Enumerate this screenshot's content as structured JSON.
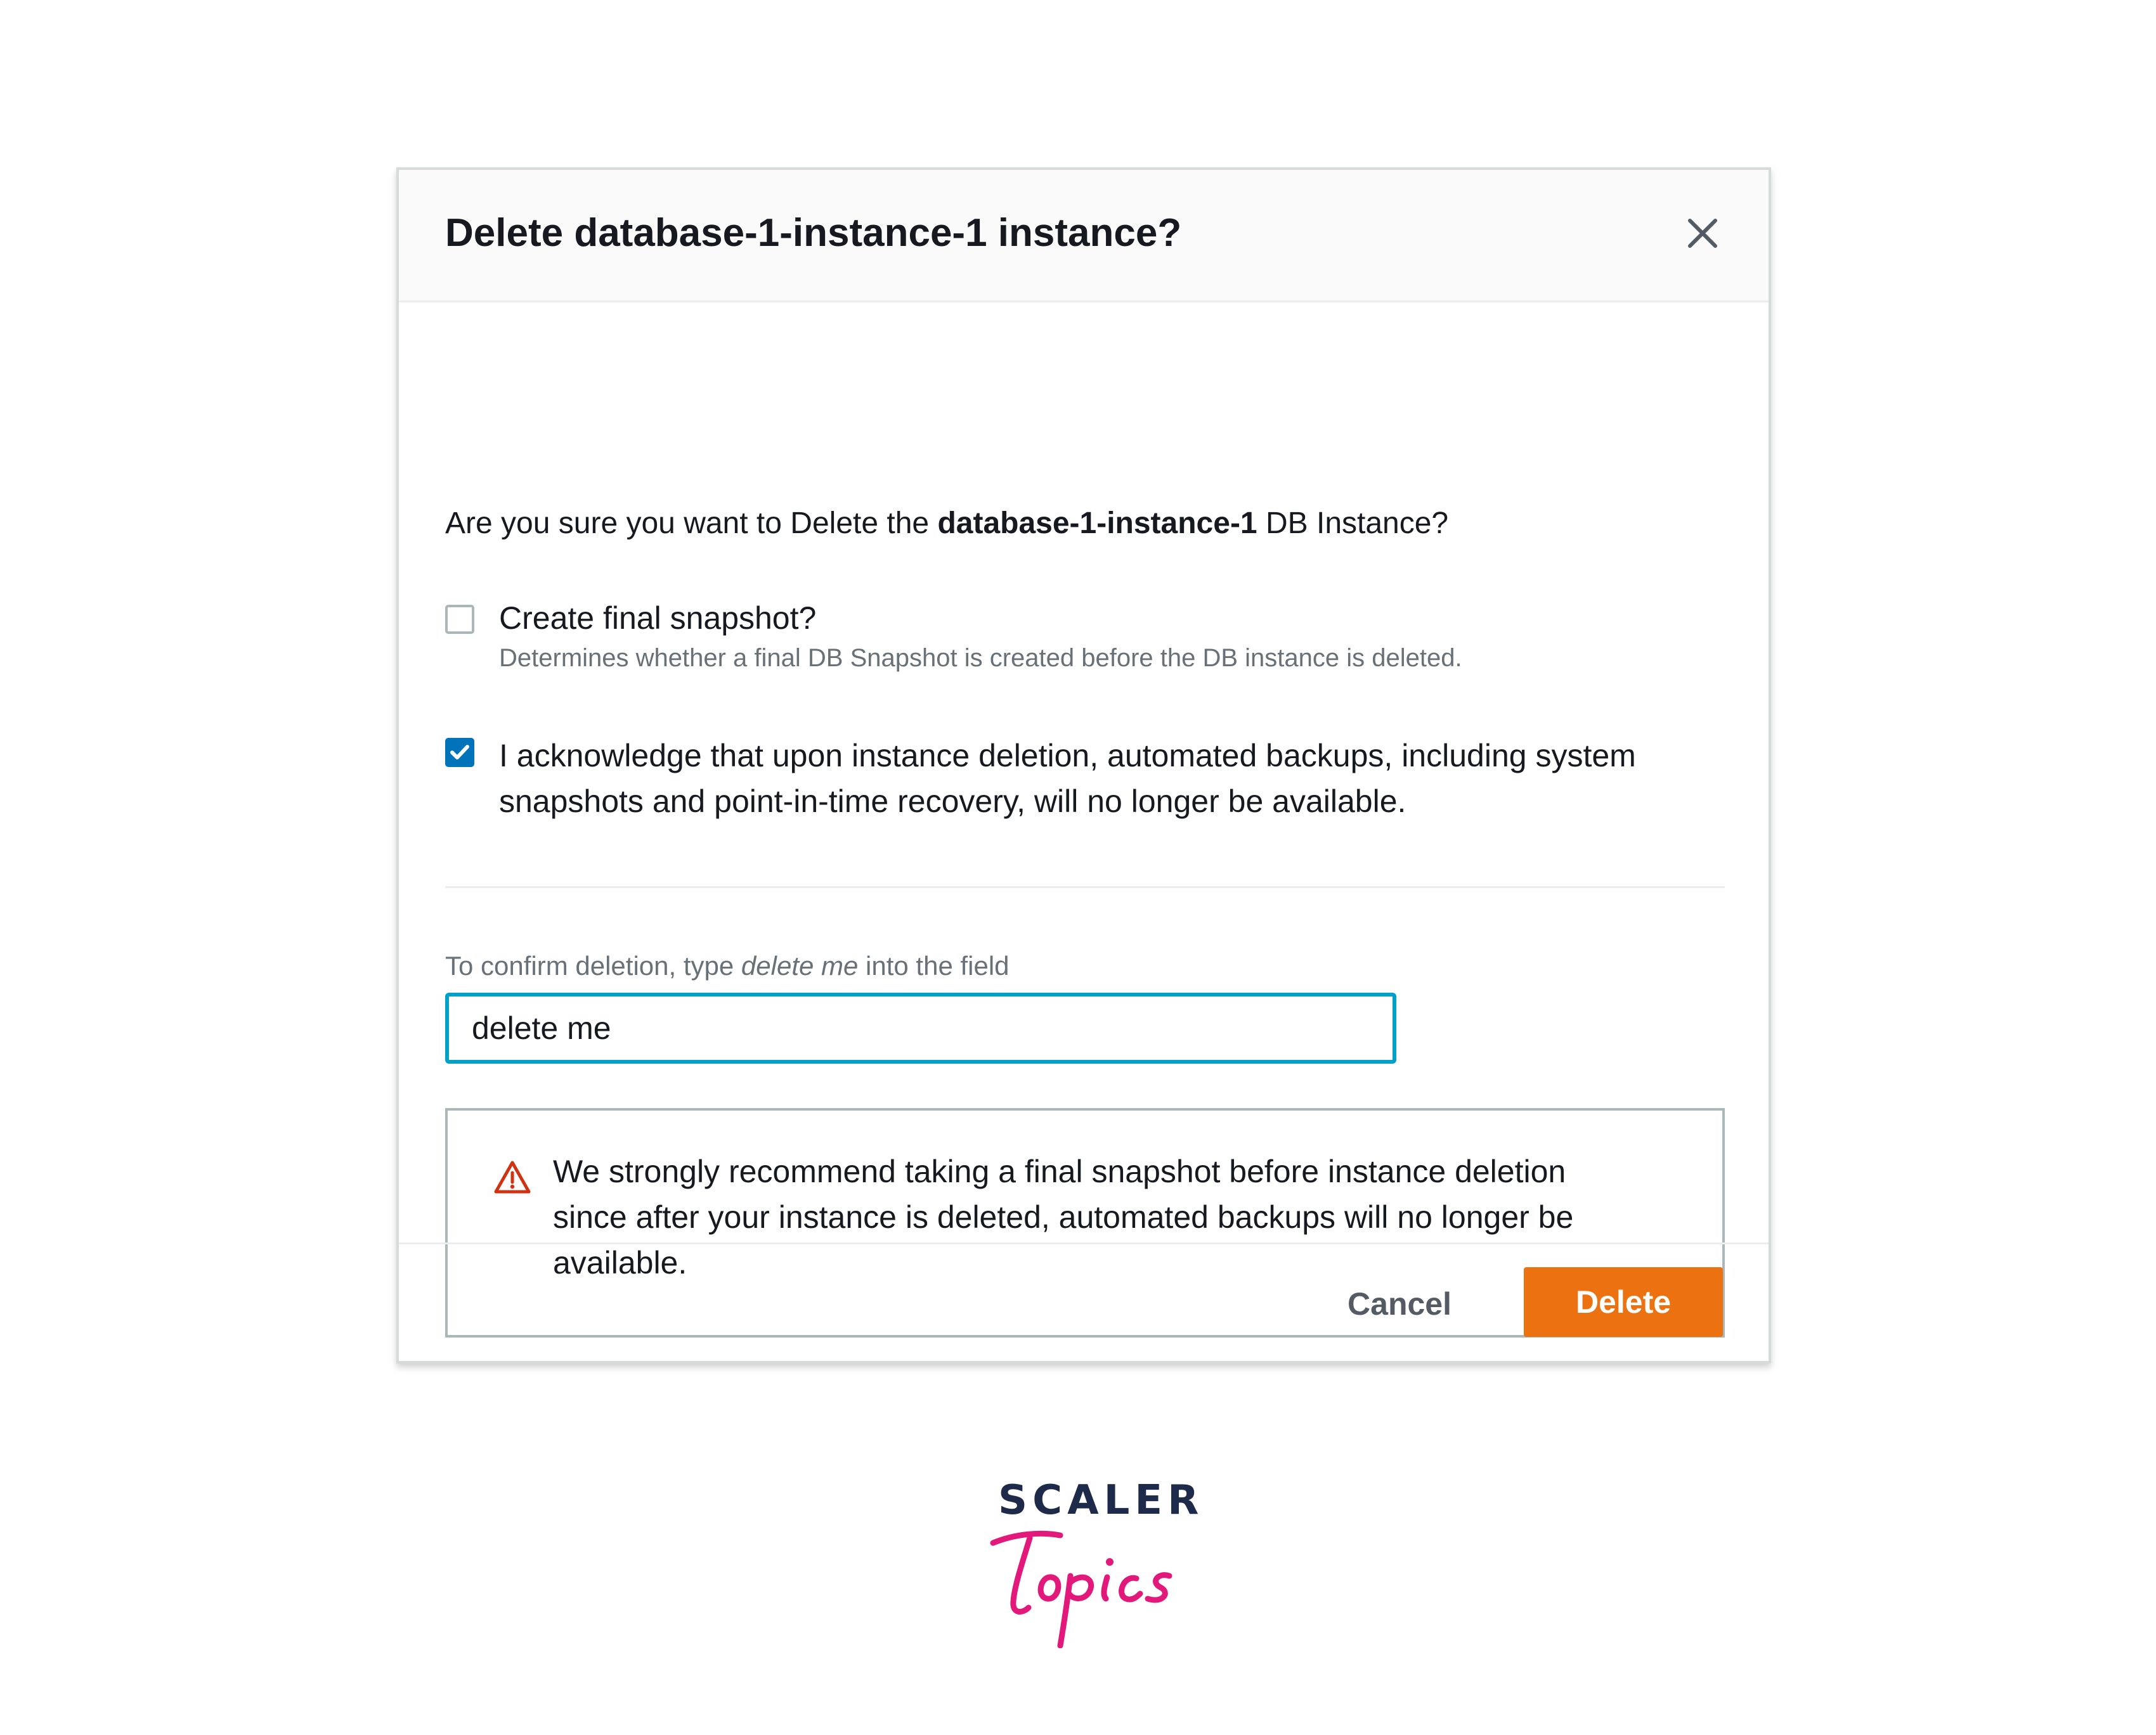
{
  "modal": {
    "title": "Delete database-1-instance-1 instance?",
    "question": {
      "prefix": "Are you sure you want to Delete the ",
      "instance_name": "database-1-instance-1",
      "suffix": " DB Instance?"
    },
    "snapshot_option": {
      "label": "Create final snapshot?",
      "description": "Determines whether a final DB Snapshot is created before the DB instance is deleted.",
      "checked": false
    },
    "acknowledge_option": {
      "line1": "I acknowledge that upon instance deletion, automated backups, including system",
      "line2": "snapshots and point-in-time recovery, will no longer be available.",
      "checked": true
    },
    "confirm": {
      "label_prefix": "To confirm deletion, type ",
      "label_keyword": "delete me",
      "label_suffix": " into the field",
      "value": "delete me"
    },
    "warning": {
      "text": "We strongly recommend taking a final snapshot before instance deletion since after your instance is deleted, automated backups will no longer be available.",
      "icon": "warning-triangle-icon",
      "color": "#d13212"
    },
    "footer": {
      "cancel_label": "Cancel",
      "delete_label": "Delete",
      "delete_color": "#ec7211"
    },
    "close_icon": "close-icon"
  },
  "brand": {
    "name": "SCALER",
    "sub": "Topics",
    "color_dark": "#1e2a4a",
    "color_accent": "#e2197a"
  }
}
